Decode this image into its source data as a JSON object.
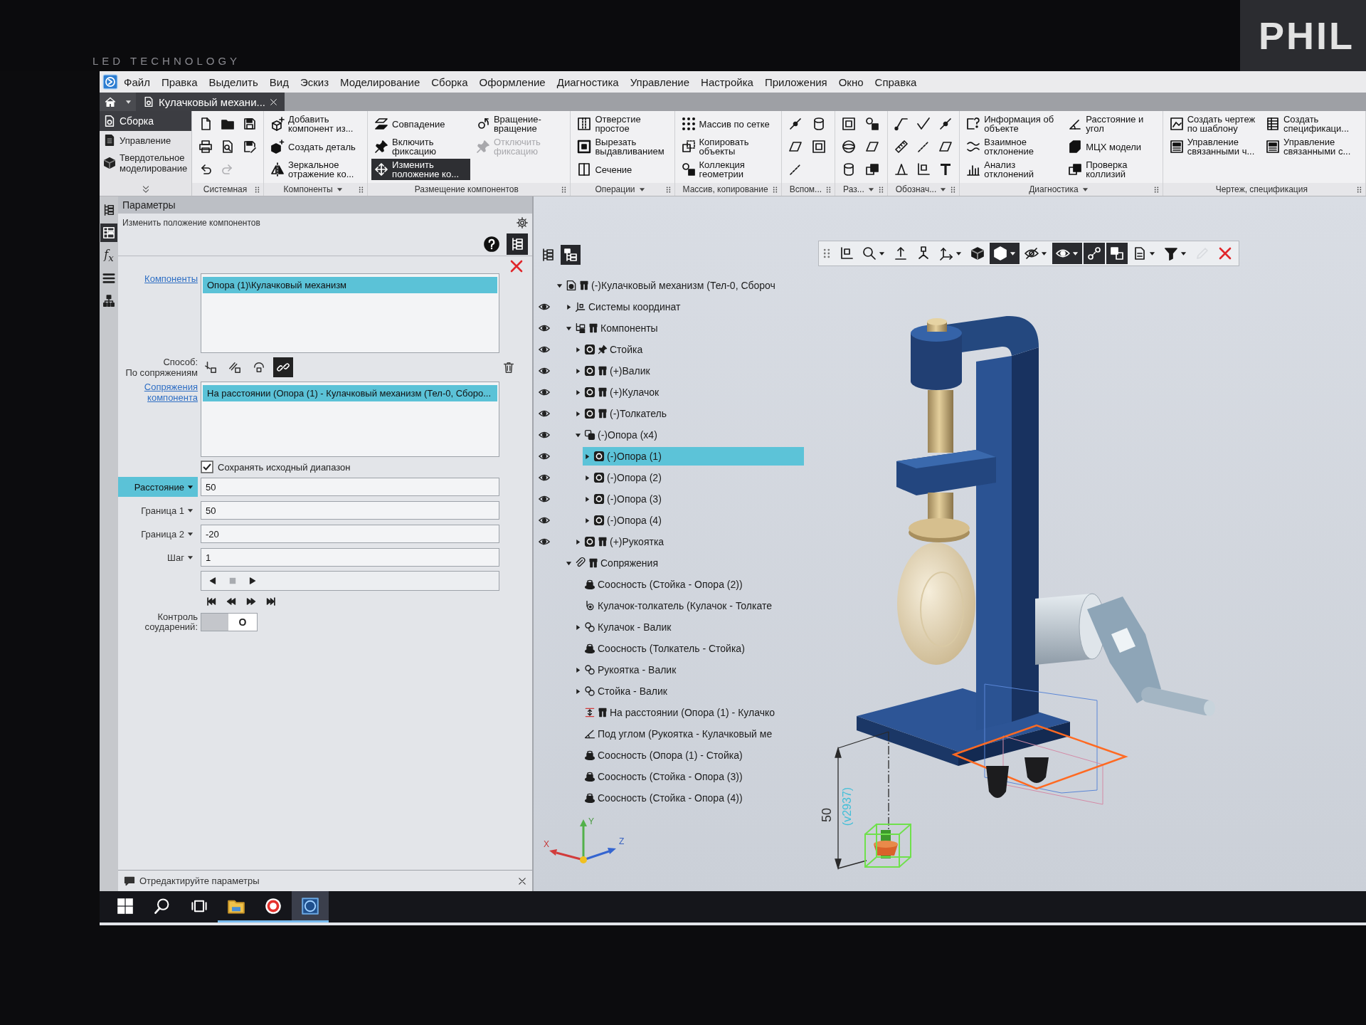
{
  "monitor": {
    "brand": "LED TECHNOLOGY",
    "background_logo": "PHIL"
  },
  "menu_bar": {
    "items": [
      "Файл",
      "Правка",
      "Выделить",
      "Вид",
      "Эскиз",
      "Моделирование",
      "Сборка",
      "Оформление",
      "Диагностика",
      "Управление",
      "Настройка",
      "Приложения",
      "Окно",
      "Справка"
    ]
  },
  "document_tabs": [
    {
      "label": "Кулачковый механи...",
      "selected": true
    }
  ],
  "ribbon": {
    "modes": [
      {
        "label": "Сборка",
        "selected": true
      },
      {
        "label": "Управление",
        "selected": false
      },
      {
        "label": "Твердотельное моделирование",
        "selected": false
      }
    ],
    "groups": [
      {
        "title": "Системная",
        "menu": false,
        "tools": [
          {
            "disabled": false
          },
          {
            "disabled": false
          },
          {
            "disabled": false
          },
          {
            "disabled": false
          },
          {
            "disabled": false
          },
          {
            "disabled": true
          },
          {
            "disabled": false
          },
          {
            "disabled": false
          }
        ]
      },
      {
        "title": "Компоненты",
        "menu": true,
        "buttons": [
          {
            "label": "Добавить компонент из..."
          },
          {
            "label": "Создать деталь"
          },
          {
            "label": "Зеркальное отражение ко..."
          }
        ]
      },
      {
        "title": "Размещение компонентов",
        "menu": false,
        "buttons": [
          {
            "label": "Совпадение",
            "selected": false,
            "disabled": false
          },
          {
            "label": "Включить фиксацию",
            "selected": false,
            "disabled": false
          },
          {
            "label": "Изменить положение ко...",
            "selected": true,
            "disabled": false
          },
          {
            "label": "Вращение-вращение",
            "selected": false,
            "disabled": false
          },
          {
            "label": "Отключить фиксацию",
            "selected": false,
            "disabled": true
          }
        ]
      },
      {
        "title": "Операции",
        "menu": true,
        "buttons": [
          {
            "label": "Отверстие простое"
          },
          {
            "label": "Вырезать выдавливанием"
          },
          {
            "label": "Сечение"
          }
        ]
      },
      {
        "title": "Массив, копирование",
        "menu": false,
        "buttons": [
          {
            "label": "Массив по сетке"
          },
          {
            "label": "Копировать объекты"
          },
          {
            "label": "Коллекция геометрии"
          }
        ]
      },
      {
        "title": "Вспом...",
        "menu": false,
        "tools": [
          {
            "disabled": false
          },
          {
            "disabled": false
          },
          {
            "disabled": false
          },
          {
            "disabled": false
          },
          {
            "disabled": false
          }
        ]
      },
      {
        "title": "Раз...",
        "menu": true,
        "tools": [
          {
            "disabled": false
          },
          {
            "disabled": false
          },
          {
            "disabled": false
          },
          {
            "disabled": false
          },
          {
            "disabled": false
          },
          {
            "disabled": false
          }
        ]
      },
      {
        "title": "Обознач...",
        "menu": true,
        "tools": [
          {
            "disabled": false
          },
          {
            "disabled": false
          },
          {
            "disabled": false
          },
          {
            "disabled": false
          },
          {
            "disabled": false
          },
          {
            "disabled": false
          },
          {
            "disabled": false
          },
          {
            "disabled": false
          },
          {
            "disabled": false
          }
        ]
      },
      {
        "title": "Диагностика",
        "menu": true,
        "buttons": [
          {
            "label": "Информация об объекте"
          },
          {
            "label": "Взаимное отклонение"
          },
          {
            "label": "Анализ отклонений"
          },
          {
            "label": "Расстояние и угол"
          },
          {
            "label": "МЦХ модели"
          },
          {
            "label": "Проверка коллизий"
          }
        ]
      },
      {
        "title": "Чертеж, спецификация",
        "menu": false,
        "buttons": [
          {
            "label": "Создать чертеж по шаблону"
          },
          {
            "label": "Управление связанными ч..."
          },
          {
            "label": "Создать спецификаци..."
          },
          {
            "label": "Управление связанными с..."
          }
        ]
      }
    ]
  },
  "side_toolbar": [
    {
      "selected": false
    },
    {
      "selected": true
    },
    {
      "label": "f$_{x}$",
      "selected": false
    },
    {
      "selected": false
    },
    {
      "selected": false
    }
  ],
  "parameters": {
    "header": "Параметры",
    "command": "Изменить положение компонентов",
    "structure_toggle": {
      "selected": true
    },
    "components": {
      "label": "Компоненты",
      "items": [
        {
          "text": "Опора (1)\\Кулачковый механизм",
          "selected": true
        }
      ]
    },
    "method": {
      "label": "Способ:",
      "value": "По сопряжениям",
      "options": [
        {
          "selected": false
        },
        {
          "selected": false
        },
        {
          "selected": false
        },
        {
          "selected": true
        }
      ]
    },
    "mates": {
      "label": "Сопряжения компонента",
      "items": [
        {
          "text": "На расстоянии (Опора (1) - Кулачковый механизм (Тел-0, Сборо...",
          "selected": true
        }
      ]
    },
    "keep_range": {
      "label": "Сохранять исходный диапазон",
      "checked": true
    },
    "fields": [
      {
        "label": "Расстояние",
        "value": "50",
        "selected": true
      },
      {
        "label": "Граница 1",
        "value": "50",
        "selected": false
      },
      {
        "label": "Граница 2",
        "value": "-20",
        "selected": false
      },
      {
        "label": "Шаг",
        "value": "1",
        "selected": false
      }
    ],
    "step_controls": [
      {
        "disabled": false
      },
      {
        "disabled": true
      },
      {
        "disabled": false
      }
    ],
    "collision_control": {
      "label": "Контроль соударений:",
      "on": false,
      "mark": "O"
    }
  },
  "tree": {
    "toolbar": [
      {
        "selected": false
      },
      {
        "selected": true
      }
    ],
    "nodes": [
      {
        "label": "(-)Кулачковый механизм (Тел-0, Сбороч",
        "kind": "assembly",
        "selected": false,
        "expanded": true,
        "fixed": false,
        "has_variables": true,
        "children": [
          {
            "label": "Системы координат",
            "kind": "coordinate-systems",
            "selected": false,
            "visible": true,
            "expanded": false,
            "fixed": false,
            "has_variables": false
          },
          {
            "label": "Компоненты",
            "kind": "components",
            "selected": false,
            "visible": true,
            "expanded": true,
            "fixed": false,
            "has_variables": true,
            "children": [
              {
                "label": "Стойка",
                "kind": "part",
                "selected": false,
                "visible": true,
                "expanded": false,
                "fixed": true,
                "has_variables": false
              },
              {
                "label": "(+)Валик",
                "kind": "part",
                "selected": false,
                "visible": true,
                "expanded": false,
                "fixed": false,
                "has_variables": true
              },
              {
                "label": "(+)Кулачок",
                "kind": "part",
                "selected": false,
                "visible": true,
                "expanded": false,
                "fixed": false,
                "has_variables": true
              },
              {
                "label": "(-)Толкатель",
                "kind": "part",
                "selected": false,
                "visible": true,
                "expanded": false,
                "fixed": false,
                "has_variables": true
              },
              {
                "label": "(-)Опора (x4)",
                "kind": "part-array",
                "selected": false,
                "visible": true,
                "expanded": true,
                "fixed": false,
                "has_variables": false,
                "children": [
                  {
                    "label": "(-)Опора (1)",
                    "kind": "part",
                    "selected": true,
                    "visible": true,
                    "expanded": false,
                    "fixed": false,
                    "has_variables": false
                  },
                  {
                    "label": "(-)Опора (2)",
                    "kind": "part",
                    "selected": false,
                    "visible": true,
                    "expanded": false,
                    "fixed": false,
                    "has_variables": false
                  },
                  {
                    "label": "(-)Опора (3)",
                    "kind": "part",
                    "selected": false,
                    "visible": true,
                    "expanded": false,
                    "fixed": false,
                    "has_variables": false
                  },
                  {
                    "label": "(-)Опора (4)",
                    "kind": "part",
                    "selected": false,
                    "visible": true,
                    "expanded": false,
                    "fixed": false,
                    "has_variables": false
                  }
                ]
              },
              {
                "label": "(+)Рукоятка",
                "kind": "part",
                "selected": false,
                "visible": true,
                "expanded": false,
                "fixed": false,
                "has_variables": true
              }
            ]
          },
          {
            "label": "Сопряжения",
            "kind": "mates",
            "selected": false,
            "expanded": true,
            "fixed": false,
            "has_variables": true,
            "children": [
              {
                "label": "Соосность (Стойка - Опора (2))",
                "kind": "concentric",
                "selected": false,
                "fixed": false,
                "has_variables": false
              },
              {
                "label": "Кулачок-толкатель (Кулачок - Толкате",
                "kind": "cam-follower",
                "selected": false,
                "fixed": false,
                "has_variables": false
              },
              {
                "label": "Кулачок - Валик",
                "kind": "mate-group",
                "selected": false,
                "expanded": false,
                "fixed": false,
                "has_variables": false
              },
              {
                "label": "Соосность (Толкатель - Стойка)",
                "kind": "concentric",
                "selected": false,
                "fixed": false,
                "has_variables": false
              },
              {
                "label": "Рукоятка - Валик",
                "kind": "mate-group",
                "selected": false,
                "expanded": false,
                "fixed": false,
                "has_variables": false
              },
              {
                "label": "Стойка - Валик",
                "kind": "mate-group",
                "selected": false,
                "expanded": false,
                "fixed": false,
                "has_variables": false
              },
              {
                "label": "На расстоянии (Опора (1) - Кулачко",
                "kind": "distance",
                "selected": false,
                "fixed": false,
                "has_variables": true
              },
              {
                "label": "Под углом (Рукоятка - Кулачковый ме",
                "kind": "angle",
                "selected": false,
                "fixed": false,
                "has_variables": false
              },
              {
                "label": "Соосность (Опора (1) - Стойка)",
                "kind": "concentric",
                "selected": false,
                "fixed": false,
                "has_variables": false
              },
              {
                "label": "Соосность (Стойка - Опора (3))",
                "kind": "concentric",
                "selected": false,
                "fixed": false,
                "has_variables": false
              },
              {
                "label": "Соосность (Стойка - Опора (4))",
                "kind": "concentric",
                "selected": false,
                "fixed": false,
                "has_variables": false
              }
            ]
          }
        ]
      }
    ]
  },
  "view_toolbar": [
    {
      "selected": false,
      "menu": false,
      "disabled": false
    },
    {
      "selected": false,
      "menu": true,
      "disabled": false
    },
    {
      "selected": false,
      "menu": false,
      "disabled": false
    },
    {
      "selected": false,
      "menu": false,
      "disabled": false
    },
    {
      "selected": false,
      "menu": true,
      "disabled": false
    },
    {
      "selected": false,
      "menu": false,
      "disabled": false
    },
    {
      "selected": true,
      "menu": true,
      "disabled": false
    },
    {
      "selected": false,
      "menu": true,
      "disabled": false
    },
    {
      "selected": true,
      "menu": true,
      "disabled": false
    },
    {
      "selected": true,
      "menu": false,
      "disabled": false
    },
    {
      "selected": true,
      "menu": false,
      "disabled": false
    },
    {
      "selected": false,
      "menu": true,
      "disabled": false
    },
    {
      "selected": false,
      "menu": true,
      "disabled": false
    },
    {
      "selected": false,
      "menu": false,
      "disabled": true
    },
    {
      "selected": false,
      "menu": false,
      "disabled": false
    }
  ],
  "viewport": {
    "dimension": {
      "value": "50",
      "variable": "(v2937)"
    },
    "axes": {
      "x": "X",
      "y": "Y",
      "z": "Z"
    }
  },
  "status_bar": {
    "message": "Отредактируйте параметры"
  },
  "taskbar": [
    {
      "selected": false,
      "running": false
    },
    {
      "selected": false,
      "running": false
    },
    {
      "selected": false,
      "running": false
    },
    {
      "selected": false,
      "running": true
    },
    {
      "selected": false,
      "running": true
    },
    {
      "selected": true,
      "running": true
    }
  ]
}
